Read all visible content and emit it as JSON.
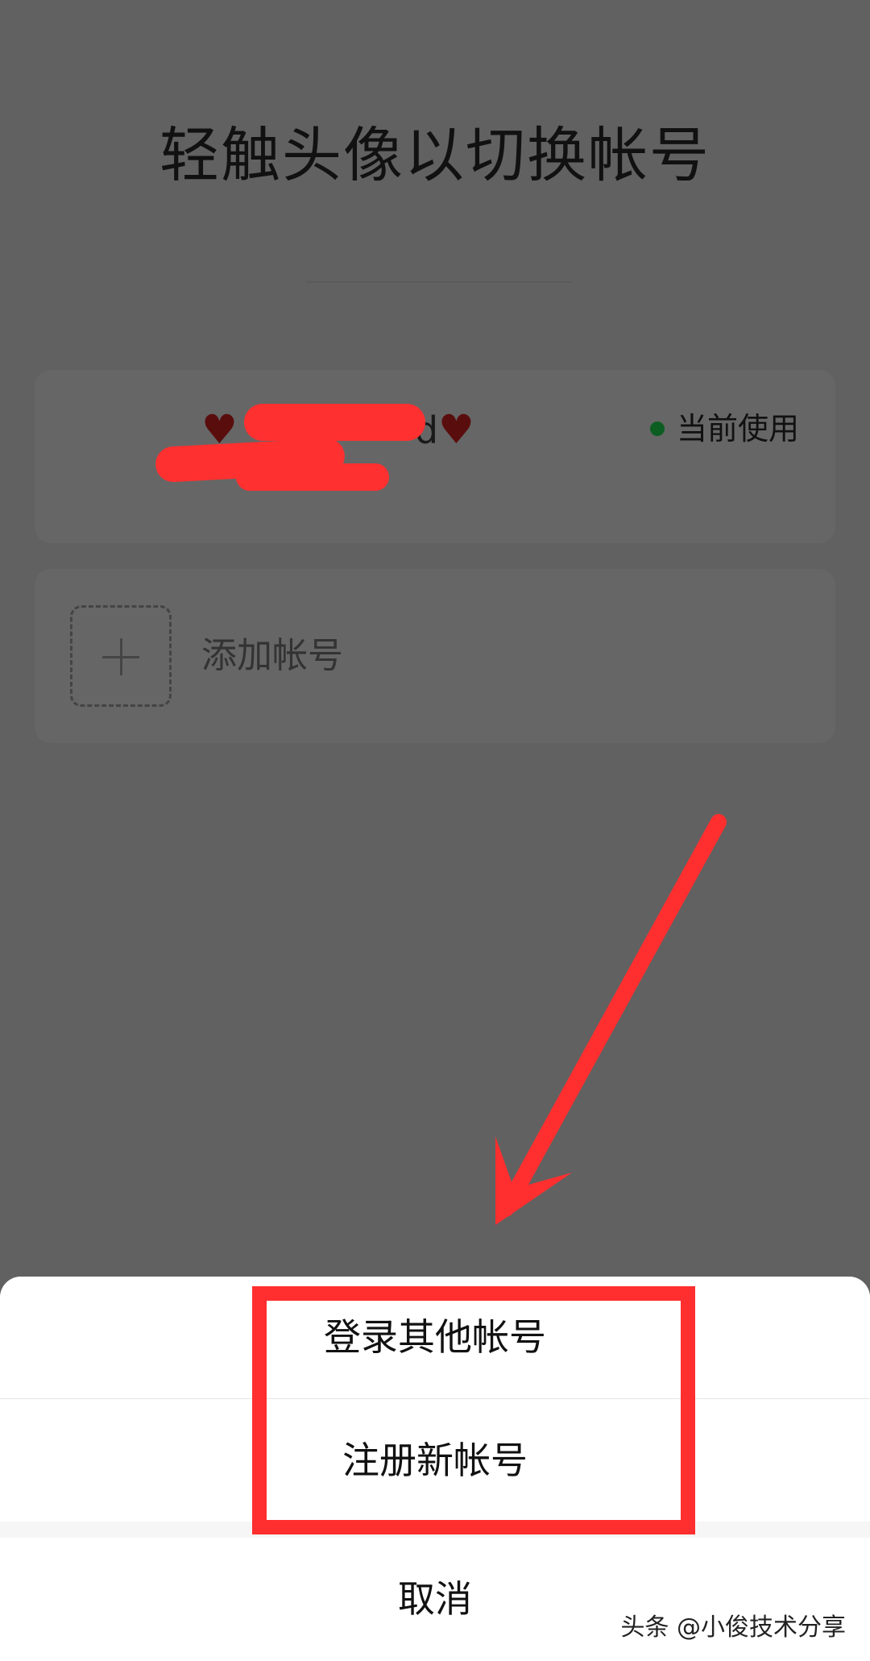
{
  "page": {
    "title": "轻触头像以切换帐号"
  },
  "current_account": {
    "name_left_emoji": "♥",
    "name_text": "d",
    "name_right_emoji": "♥",
    "status_label": "当前使用",
    "status_color": "#0b5d22"
  },
  "add_account": {
    "label": "添加帐号"
  },
  "action_sheet": {
    "login_other_account": "登录其他帐号",
    "register_new_account": "注册新帐号",
    "cancel": "取消"
  },
  "watermark": {
    "text": "头条 @小俊技术分享"
  },
  "colors": {
    "overlay_background": "#616161",
    "highlight_red": "#ff2f2f",
    "sheet_background": "#f6f6f6"
  }
}
